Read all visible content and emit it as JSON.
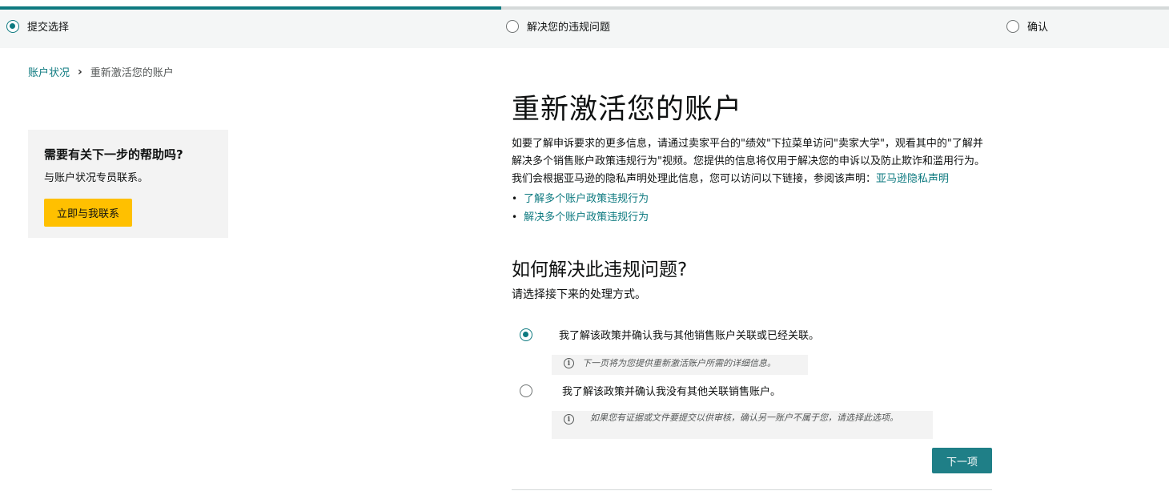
{
  "stepper": {
    "progress_fraction": 0.429,
    "steps": [
      {
        "label": "提交选择",
        "state": "current"
      },
      {
        "label": "解决您的违规问题",
        "state": "pending"
      },
      {
        "label": "确认",
        "state": "pending"
      }
    ]
  },
  "breadcrumb": {
    "parent": "账户状况",
    "separator": "›",
    "current": "重新激活您的账户"
  },
  "help": {
    "title": "需要有关下一步的帮助吗?",
    "subtitle": "与账户状况专员联系。",
    "button_label": "立即与我联系"
  },
  "main": {
    "title": "重新激活您的账户",
    "intro_text": "如要了解申诉要求的更多信息，请通过卖家平台的\"绩效\"下拉菜单访问\"卖家大学\"，观看其中的\"了解并解决多个销售账户政策违规行为\"视频。您提供的信息将仅用于解决您的申诉以及防止欺诈和滥用行为。我们会根据亚马逊的隐私声明处理此信息，您可以访问以下链接，参阅该声明：",
    "intro_link": "亚马逊隐私声明",
    "links": [
      "了解多个账户政策违规行为",
      "解决多个账户政策违规行为"
    ],
    "section_title": "如何解决此违规问题?",
    "section_subtitle": "请选择接下来的处理方式。",
    "options": [
      {
        "label": "我了解该政策并确认我与其他销售账户关联或已经关联。",
        "selected": true,
        "info": "下一页将为您提供重新激活账户所需的详细信息。"
      },
      {
        "label": "我了解该政策并确认我没有其他关联销售账户。",
        "selected": false,
        "info": "如果您有证据或文件要提交以供审核，确认另一账户不属于您，请选择此选项。"
      }
    ],
    "next_label": "下一项"
  },
  "colors": {
    "accent": "#0e7a80",
    "button_primary": "#1f7f87",
    "contact_button": "#ffc000"
  },
  "icons": {
    "info": "info-icon",
    "breadcrumb_separator": "chevron-right-icon"
  }
}
